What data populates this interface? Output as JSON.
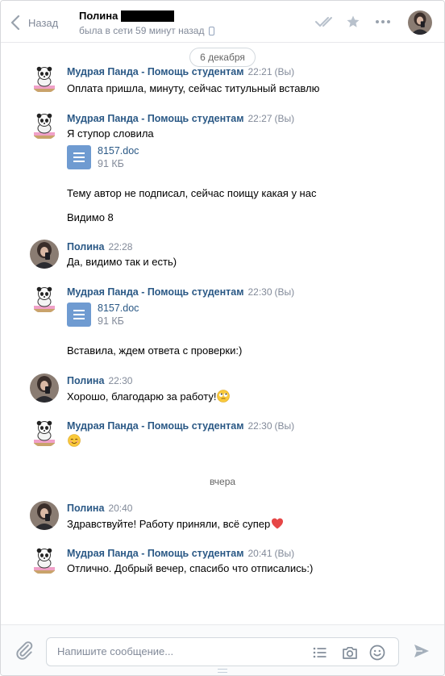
{
  "header": {
    "back_label": "Назад",
    "peer_name": "Полина",
    "peer_status": "была в сети 59 минут назад"
  },
  "history": {
    "date_1": "6 декабря",
    "date_2": "вчера",
    "messages": [
      {
        "author": "Мудрая Панда - Помощь студентам",
        "time": "22:21",
        "you": "(Вы)",
        "lines": [
          "Оплата пришла, минуту, сейчас титульный вставлю"
        ]
      },
      {
        "author": "Мудрая Панда - Помощь студентам",
        "time": "22:27",
        "you": "(Вы)",
        "lines": [
          "Я ступор словила",
          "Тему автор не подписал, сейчас поищу какая у нас",
          "Видимо 8"
        ],
        "doc": {
          "name": "8157.doc",
          "size": "91 КБ"
        }
      },
      {
        "author": "Полина",
        "time": "22:28",
        "lines": [
          "Да, видимо так и есть)"
        ]
      },
      {
        "author": "Мудрая Панда - Помощь студентам",
        "time": "22:30",
        "you": "(Вы)",
        "lines": [
          "Вставила, ждем ответа с проверки:)"
        ],
        "doc": {
          "name": "8157.doc",
          "size": "91 КБ"
        }
      },
      {
        "author": "Полина",
        "time": "22:30",
        "lines": [
          "Хорошо, благодарю за работу!"
        ],
        "emoji": "rolling-eyes-emoji"
      },
      {
        "author": "Мудрая Панда - Помощь студентам",
        "time": "22:30",
        "you": "(Вы)",
        "emoji": "smiling-face-emoji"
      },
      {
        "author": "Полина",
        "time": "20:40",
        "lines": [
          "Здравствуйте! Работу приняли, всё супер"
        ],
        "emoji": "red-heart-emoji"
      },
      {
        "author": "Мудрая Панда - Помощь студентам",
        "time": "20:41",
        "you": "(Вы)",
        "lines": [
          "Отлично. Добрый вечер, спасибо что отписались:)"
        ]
      }
    ]
  },
  "composer": {
    "placeholder": "Напишите сообщение..."
  },
  "colors": {
    "link": "#2a5885",
    "muted": "#828a99",
    "doc_icon": "#6f9bd1",
    "heart": "#e64646"
  }
}
